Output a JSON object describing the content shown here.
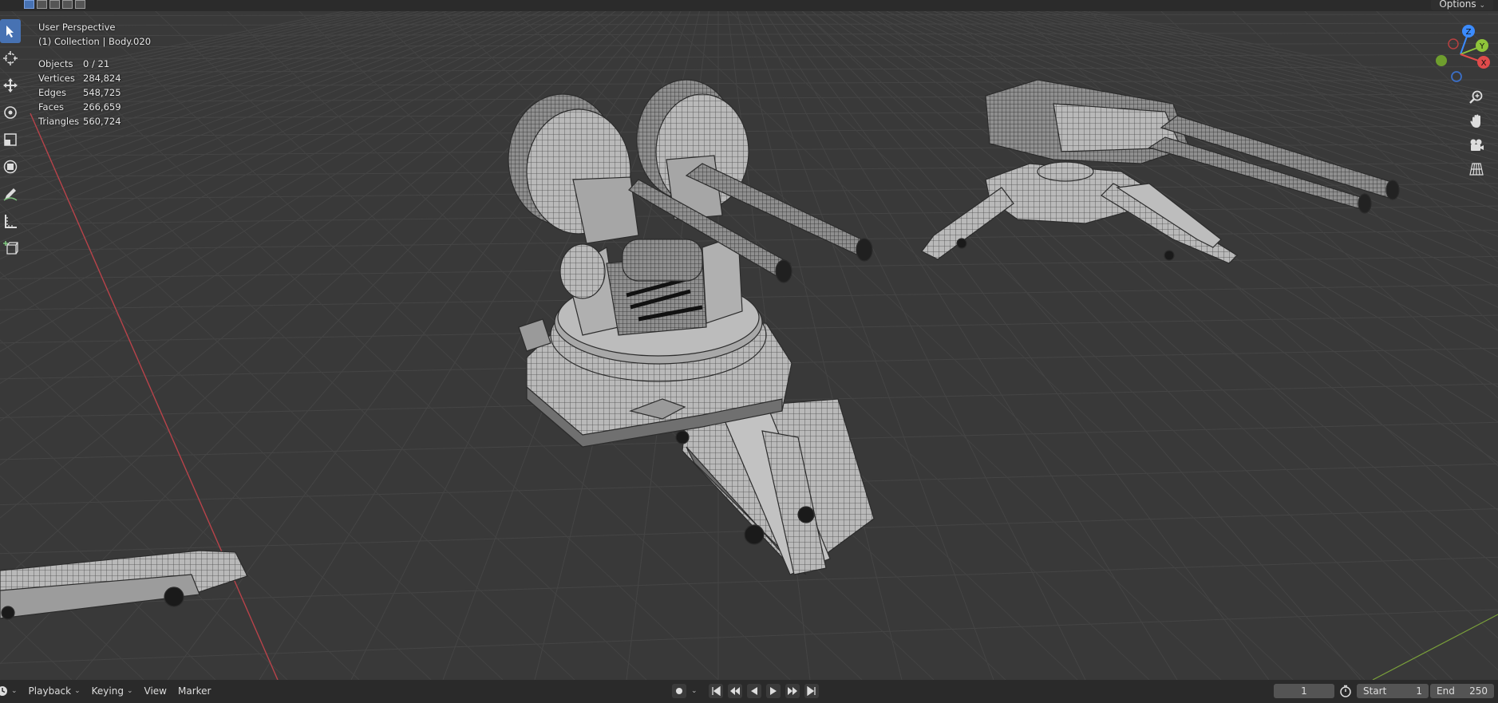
{
  "viewport": {
    "view_name": "User Perspective",
    "collection_info": "(1) Collection | Body.020",
    "stats": [
      {
        "label": "Objects",
        "value": "0 / 21"
      },
      {
        "label": "Vertices",
        "value": "284,824"
      },
      {
        "label": "Edges",
        "value": "548,725"
      },
      {
        "label": "Faces",
        "value": "266,659"
      },
      {
        "label": "Triangles",
        "value": "560,724"
      }
    ],
    "options_label": "Options"
  },
  "gizmo": {
    "z": "Z",
    "y": "Y",
    "x": "X"
  },
  "timeline": {
    "playback": "Playback",
    "keying": "Keying",
    "view": "View",
    "marker": "Marker",
    "current_frame": "1",
    "start_label": "Start",
    "start_value": "1",
    "end_label": "End",
    "end_value": "250"
  },
  "colors": {
    "accent": "#4772b3",
    "x_axis": "#e04b4b",
    "y_axis": "#8fc43a",
    "z_axis": "#3b8bff"
  }
}
